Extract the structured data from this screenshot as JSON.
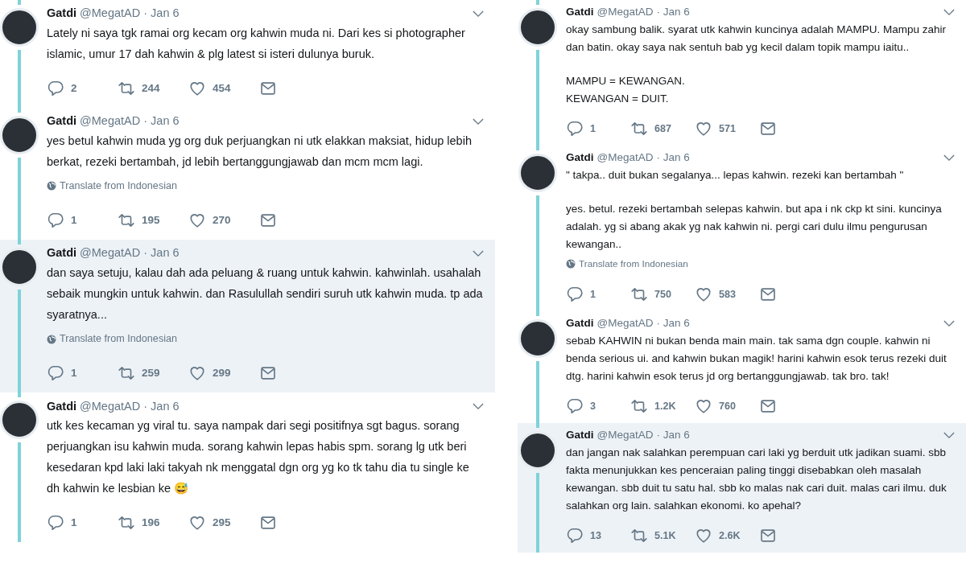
{
  "columns": [
    {
      "tweets": [
        {
          "name": "Gatdi",
          "handle": "@MegatAD",
          "date": "· Jan 6",
          "highlighted": false,
          "paragraphs": [
            "Lately ni saya tgk ramai org kecam org kahwin muda ni. Dari kes si photographer islamic, umur 17 dah kahwin & plg latest si isteri dulunya buruk."
          ],
          "replies": "2",
          "retweets": "244",
          "likes": "454"
        },
        {
          "name": "Gatdi",
          "handle": "@MegatAD",
          "date": "· Jan 6",
          "highlighted": false,
          "paragraphs": [
            "yes betul kahwin muda yg org duk perjuangkan ni utk elakkan maksiat, hidup lebih berkat, rezeki bertambah, jd lebih bertanggungjawab dan mcm mcm lagi."
          ],
          "translate": "Translate from Indonesian",
          "replies": "1",
          "retweets": "195",
          "likes": "270"
        },
        {
          "name": "Gatdi",
          "handle": "@MegatAD",
          "date": "· Jan 6",
          "highlighted": true,
          "paragraphs": [
            "dan saya setuju, kalau dah ada peluang & ruang untuk kahwin. kahwinlah. usahalah sebaik mungkin untuk kahwin. dan Rasulullah sendiri suruh utk kahwin muda. tp ada syaratnya..."
          ],
          "translate": "Translate from Indonesian",
          "replies": "1",
          "retweets": "259",
          "likes": "299"
        },
        {
          "name": "Gatdi",
          "handle": "@MegatAD",
          "date": "· Jan 6",
          "highlighted": false,
          "paragraphs": [
            "utk kes kecaman yg viral tu. saya nampak dari segi positifnya sgt bagus. sorang perjuangkan isu kahwin muda. sorang kahwin lepas habis spm. sorang lg utk beri kesedaran kpd laki laki takyah nk menggatal dgn org yg ko tk tahu dia tu single ke dh kahwin ke lesbian ke 😅"
          ],
          "replies": "1",
          "retweets": "196",
          "likes": "295"
        }
      ]
    },
    {
      "tweets": [
        {
          "name": "Gatdi",
          "handle": "@MegatAD",
          "date": "· Jan 6",
          "highlighted": false,
          "paragraphs": [
            "okay sambung balik. syarat utk kahwin kuncinya adalah MAMPU. Mampu zahir dan batin. okay saya nak sentuh bab yg kecil dalam topik mampu iaitu..",
            "MAMPU = KEWANGAN.\nKEWANGAN = DUIT."
          ],
          "replies": "1",
          "retweets": "687",
          "likes": "571"
        },
        {
          "name": "Gatdi",
          "handle": "@MegatAD",
          "date": "· Jan 6",
          "highlighted": false,
          "paragraphs": [
            "\" takpa.. duit bukan segalanya... lepas kahwin. rezeki kan bertambah \"",
            "yes. betul. rezeki bertambah selepas kahwin. but apa i nk ckp kt sini. kuncinya adalah. yg si abang akak yg nak kahwin ni. pergi cari dulu ilmu pengurusan kewangan.."
          ],
          "translate": "Translate from Indonesian",
          "replies": "1",
          "retweets": "750",
          "likes": "583"
        },
        {
          "name": "Gatdi",
          "handle": "@MegatAD",
          "date": "· Jan 6",
          "highlighted": false,
          "paragraphs": [
            "sebab KAHWIN ni bukan benda main main. tak sama dgn couple. kahwin ni benda serious ui. and kahwin bukan magik! harini kahwin esok terus rezeki duit dtg. harini kahwin esok terus jd org bertanggungjawab. tak bro. tak!"
          ],
          "replies": "3",
          "retweets": "1.2K",
          "likes": "760"
        },
        {
          "name": "Gatdi",
          "handle": "@MegatAD",
          "date": "· Jan 6",
          "highlighted": true,
          "paragraphs": [
            "dan jangan nak salahkan perempuan cari laki yg berduit utk jadikan suami. sbb fakta menunjukkan kes penceraian paling tinggi disebabkan oleh masalah kewangan. sbb duit tu satu hal. sbb ko malas nak cari duit. malas cari ilmu. duk salahkan org lain. salahkan ekonomi. ko apehal?"
          ],
          "replies": "13",
          "retweets": "5.1K",
          "likes": "2.6K"
        }
      ]
    }
  ]
}
